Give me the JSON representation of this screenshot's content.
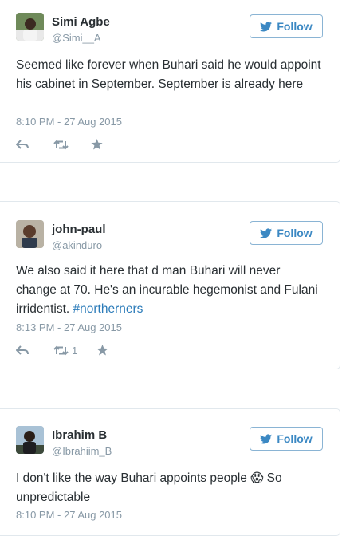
{
  "colors": {
    "accent": "#3b88c3",
    "hashtag": "#2b7bb9",
    "muted": "#8899a6",
    "border": "#e1e8ed"
  },
  "tweets": [
    {
      "name": "Simi Agbe",
      "handle": "@Simi__A",
      "follow_label": "Follow",
      "text": "Seemed like forever when Buhari said he would appoint his cabinet in September. September is already here",
      "hashtag": "",
      "timestamp": "8:10 PM - 27 Aug 2015",
      "retweet_count": ""
    },
    {
      "name": "john-paul",
      "handle": "@akinduro",
      "follow_label": "Follow",
      "text": "We also said it here that d man Buhari will never change at 70. He's an incurable hegemonist and Fulani irridentist. ",
      "hashtag": "#northerners",
      "timestamp": "8:13 PM - 27 Aug 2015",
      "retweet_count": "1"
    },
    {
      "name": "Ibrahim B",
      "handle": "@Ibrahiim_B",
      "follow_label": "Follow",
      "text": "I don't like the way Buhari appoints people 😱  So unpredictable",
      "hashtag": "",
      "timestamp": "8:10 PM - 27 Aug 2015",
      "retweet_count": ""
    }
  ]
}
